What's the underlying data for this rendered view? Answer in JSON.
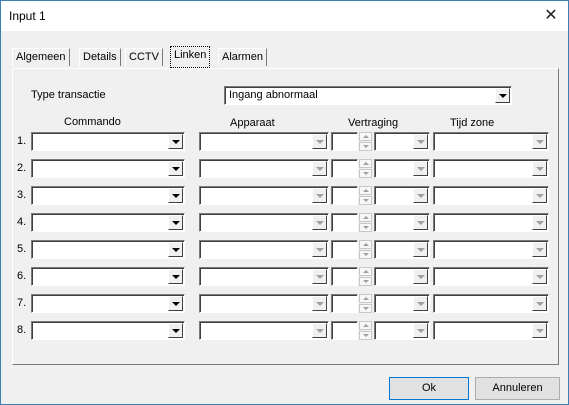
{
  "window": {
    "title": "Input 1"
  },
  "tabs": [
    {
      "label": "Algemeen"
    },
    {
      "label": "Details"
    },
    {
      "label": "CCTV"
    },
    {
      "label": "Linken"
    },
    {
      "label": "Alarmen"
    }
  ],
  "form": {
    "type_label": "Type transactie",
    "type_value": "Ingang abnormaal"
  },
  "columns": {
    "commando": "Commando",
    "apparaat": "Apparaat",
    "vertraging": "Vertraging",
    "tijd_zone": "Tijd zone"
  },
  "rows": [
    {
      "num": "1."
    },
    {
      "num": "2."
    },
    {
      "num": "3."
    },
    {
      "num": "4."
    },
    {
      "num": "5."
    },
    {
      "num": "6."
    },
    {
      "num": "7."
    },
    {
      "num": "8."
    }
  ],
  "buttons": {
    "ok": "Ok",
    "cancel": "Annuleren"
  }
}
